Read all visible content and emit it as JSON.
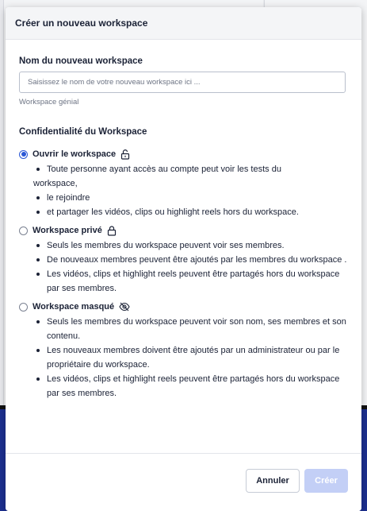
{
  "modal": {
    "title": "Créer un nouveau workspace"
  },
  "name_field": {
    "label": "Nom du nouveau workspace",
    "placeholder": "Saisissez le nom de votre nouveau workspace ici ...",
    "value": "",
    "helper": "Workspace génial"
  },
  "privacy": {
    "title": "Confidentialité du Workspace",
    "options": [
      {
        "label": "Ouvrir le workspace",
        "icon": "unlock-icon",
        "selected": true,
        "bullets": [
          "Toute personne ayant accès au compte peut voir les tests du",
          "workspace,",
          "le rejoindre",
          "et partager les vidéos, clips ou highlight reels hors du workspace."
        ]
      },
      {
        "label": "Workspace privé",
        "icon": "lock-icon",
        "selected": false,
        "bullets": [
          "Seuls les membres du workspace peuvent voir ses membres.",
          "De nouveaux membres peuvent être ajoutés par les membres du workspace .",
          "Les vidéos, clips et highlight reels peuvent être partagés hors du workspace par ses membres."
        ]
      },
      {
        "label": "Workspace masqué",
        "icon": "eye-off-icon",
        "selected": false,
        "bullets": [
          "Seuls les membres du workspace peuvent voir son nom, ses membres et son contenu.",
          "Les nouveaux membres doivent être ajoutés par un administrateur ou par le propriétaire du workspace.",
          "Les vidéos, clips et highlight reels peuvent être partagés hors du workspace par ses membres."
        ]
      }
    ]
  },
  "footer": {
    "cancel_label": "Annuler",
    "create_label": "Créer"
  },
  "colors": {
    "accent": "#2b58d6",
    "create_disabled": "#c3cff6",
    "text": "#1b2236",
    "muted": "#6d7484"
  }
}
